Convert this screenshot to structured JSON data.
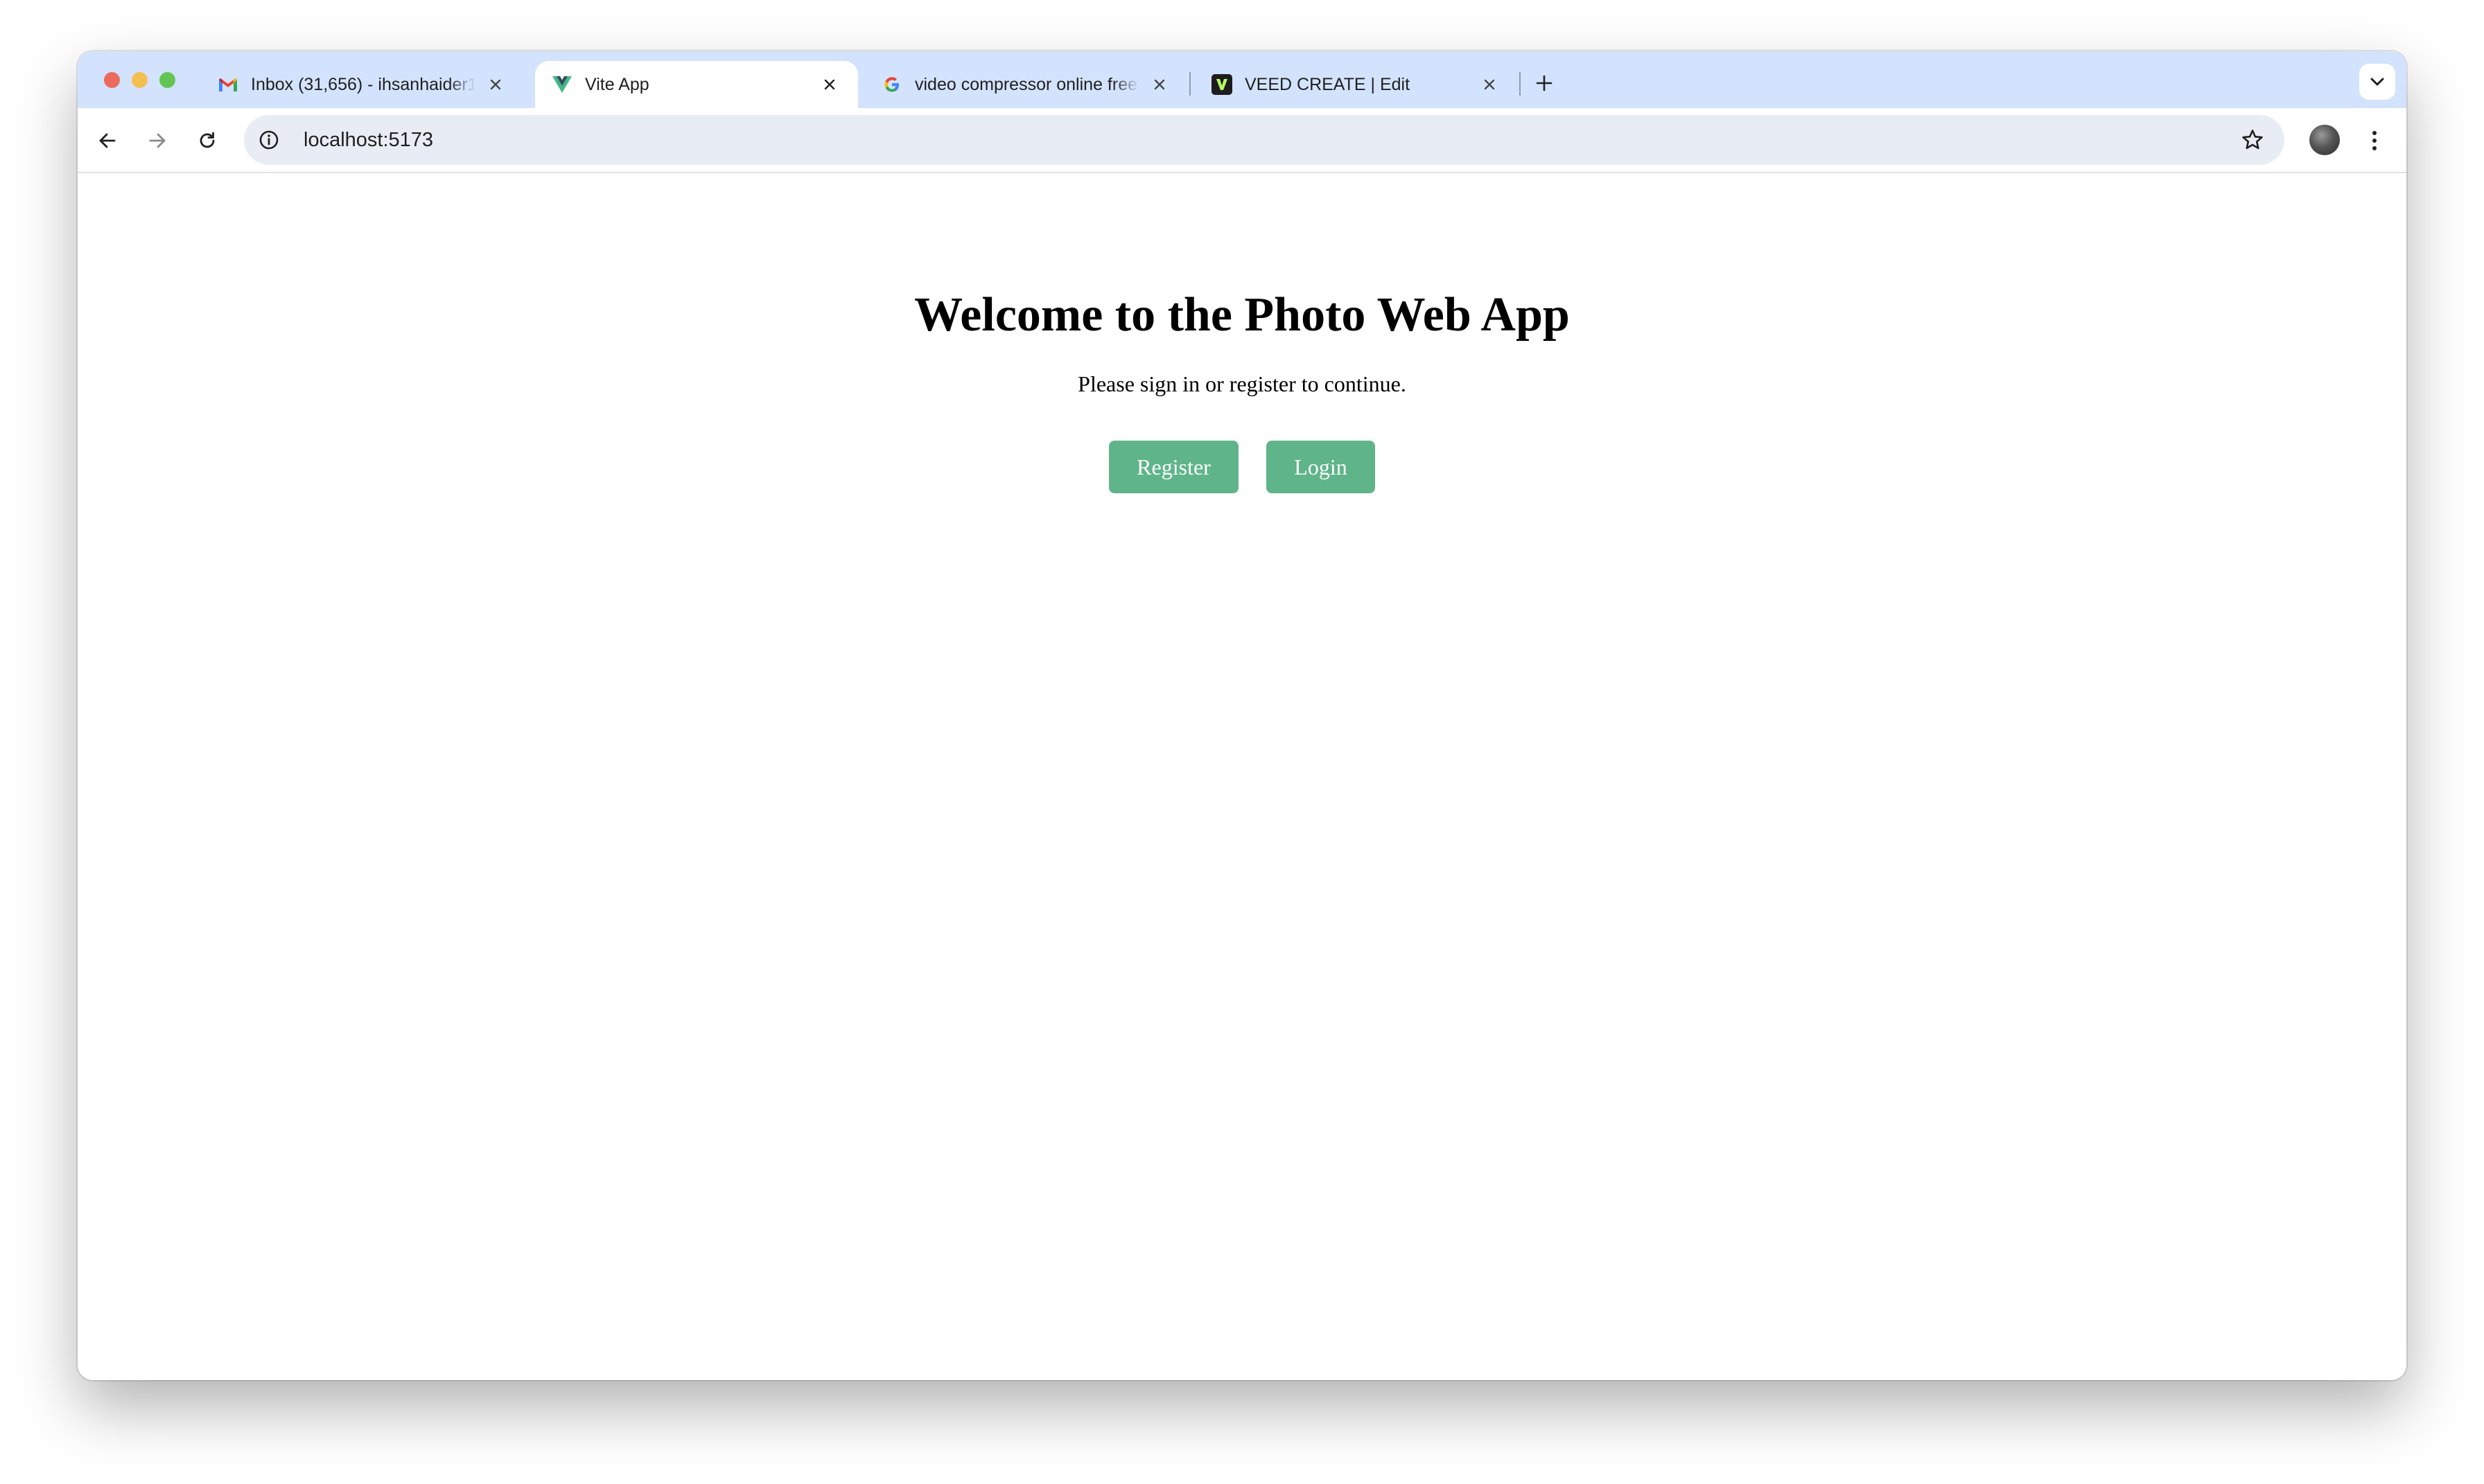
{
  "browser": {
    "tabs": [
      {
        "title": "Inbox (31,656) - ihsanhaider1",
        "favicon": "gmail-icon",
        "active": false
      },
      {
        "title": "Vite App",
        "favicon": "vue-icon",
        "active": true
      },
      {
        "title": "video compressor online free",
        "favicon": "google-icon",
        "active": false
      },
      {
        "title": "VEED CREATE | Edit",
        "favicon": "veed-icon",
        "active": false
      }
    ],
    "address_bar": {
      "url": "localhost:5173"
    },
    "colors": {
      "tabbar": "#d3e3fd",
      "omnibox": "#e8edf5",
      "traffic_close": "#ed6a5e",
      "traffic_minimize": "#f5bf4f",
      "traffic_maximize": "#61c554"
    }
  },
  "page": {
    "heading": "Welcome to the Photo Web App",
    "subtext": "Please sign in or register to continue.",
    "buttons": {
      "register_label": "Register",
      "login_label": "Login"
    },
    "colors": {
      "button_bg": "#5fb589",
      "button_text": "#ffffff"
    }
  }
}
